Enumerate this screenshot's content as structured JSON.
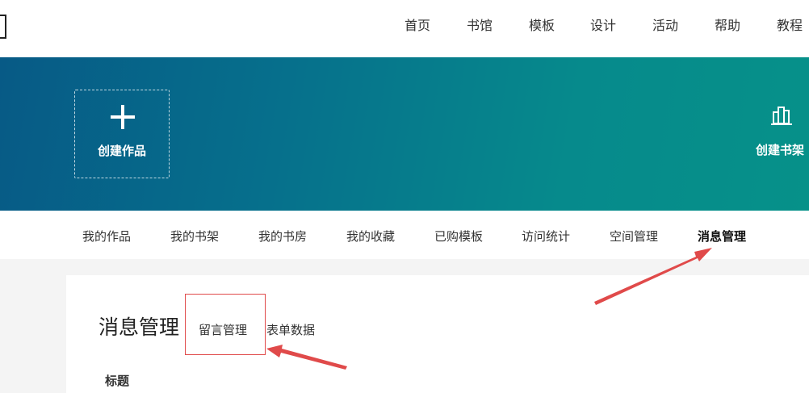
{
  "topnav": {
    "items": [
      "首页",
      "书馆",
      "模板",
      "设计",
      "活动",
      "帮助",
      "教程"
    ]
  },
  "banner": {
    "create_label": "创建作品",
    "shelf_label": "创建书架"
  },
  "subnav": {
    "items": [
      "我的作品",
      "我的书架",
      "我的书房",
      "我的收藏",
      "已购模板",
      "访问统计",
      "空间管理",
      "消息管理"
    ],
    "active": "消息管理"
  },
  "content": {
    "title": "消息管理",
    "tabs": [
      "留言管理",
      "表单数据"
    ],
    "table": {
      "columns": [
        "标题"
      ]
    }
  },
  "colors": {
    "banner_start": "#075a86",
    "banner_end": "#069189",
    "annotation": "#e04a4a"
  }
}
